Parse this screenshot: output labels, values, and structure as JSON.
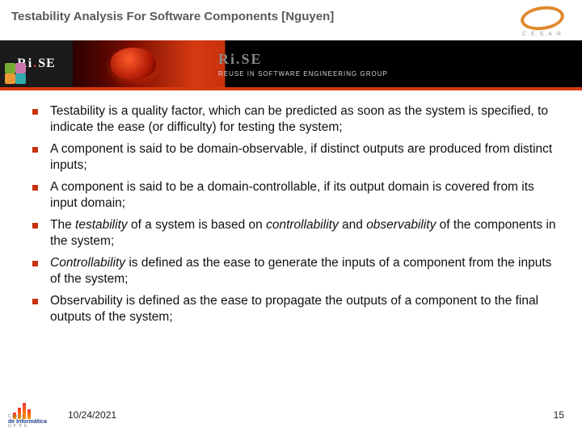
{
  "header": {
    "title": "Testability Analysis For Software Components [Nguyen]",
    "cesar_label": "C.E.S.A.R"
  },
  "banner": {
    "rise": "Ri.SE",
    "subtitle": "REUSE IN SOFTWARE ENGINEERING GROUP"
  },
  "bullets": [
    "Testability is a quality factor, which can be predicted as soon as the system is specified, to indicate the ease (or difficulty) for testing the system;",
    "A component is said to be domain-observable, if distinct outputs are produced from distinct inputs;",
    "A component is said to be a domain-controllable, if its output domain is covered from its input domain;",
    "The <em>testability</em> of a system is based on <em>controllability</em> and <em>observability</em> of the components in the system;",
    "<em>Controllability</em> is defined as the ease to generate the inputs of a component from the inputs of the system;",
    "Observability is defined as the ease to propagate the outputs of a component to the final outputs of the system;"
  ],
  "footer": {
    "centro_line1": "Centro",
    "centro_line2": "de Informática",
    "centro_line3": "U F P E",
    "date": "10/24/2021",
    "page": "15"
  }
}
